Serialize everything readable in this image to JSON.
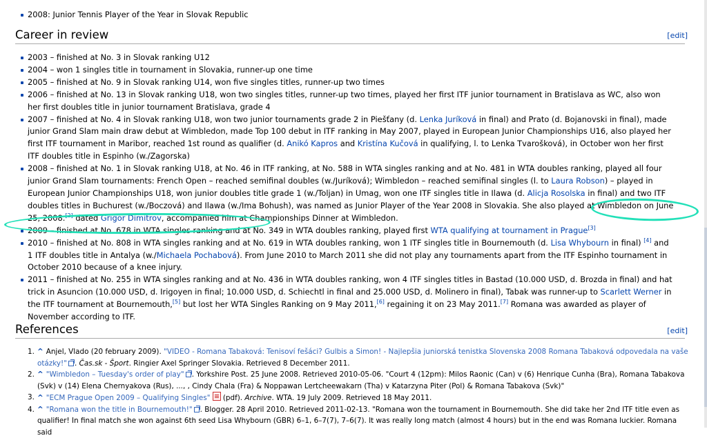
{
  "top_item": "2008: Junior Tennis Player of the Year in Slovak Republic",
  "career": {
    "heading": "Career in review",
    "edit": "[edit]",
    "items": {
      "i2003": "2003 – finished at No. 3 in Slovak ranking U12",
      "i2004": "2004 – won 1 singles title in tournament in Slovakia, runner-up one time",
      "i2005": "2005 – finished at No. 9 in Slovak ranking U14, won five singles titles, runner-up two times",
      "i2006": "2006 – finished at No. 13 in Slovak ranking U18, won two singles titles, runner-up two times, played her first ITF junior tournament in Bratislava as WC, also won her first doubles title in junior tournament Bratislava, grade 4",
      "i2007": {
        "t1": "2007 – finished at No. 4 in Slovak ranking U18, won two junior tournaments grade 2 in Piešťany (d. ",
        "l1": "Lenka Juríková",
        "t2": " in final) and Prato (d. Bojanovski in final), made junior Grand Slam main draw debut at Wimbledon, made Top 100 debut in ITF ranking in May 2007, played in European Junior Championships U16, also played her first ITF tournament in Maribor, reached 1st round as qualifier (d. ",
        "l2": "Anikó Kapros",
        "t3": " and ",
        "l3": "Kristína Kučová",
        "t4": " in qualifying, l. to Lenka Tvarošková), in October won her first ITF doubles title in Espinho (w./Zagorska)"
      },
      "i2008": {
        "t1": "2008 – finished at No. 1 in Slovak ranking U18, at No. 46 in ITF ranking, at No. 588 in WTA singles ranking and at No. 481 in WTA doubles ranking, played all four junior Grand Slam tournaments: French Open – reached semifinal doubles (w./Juríková); Wimbledon – reached semifinal singles (l. to ",
        "l1": "Laura Robson",
        "t2": ") – played in European Junior Championships U18, won junior doubles title grade 1 (w./Toljan) in Umag, won one ITF singles title in Ilawa (d. ",
        "l2": "Alicja Rosolska",
        "t3": " in final) and two ITF doubles titles in Buchurest (w./Boczová) and Ilawa (w./Ima Bohush), was named as Junior Player of the Year 2008 in Slovakia. She also played at Wimbledon on June 25, 2008.",
        "ref": "[2]",
        "t4": " dated ",
        "l3": "Grigor Dimitrov",
        "t5": ", accompanied him at Championships Dinner at Wimbledon."
      },
      "i2009": {
        "t1": "2009 – finished at No. 678 in WTA singles ranking and at No. 349 in WTA doubles ranking, played first ",
        "l1": "WTA qualifying at tournament in Prague",
        "ref": "[3]"
      },
      "i2010": {
        "t1": "2010 – finished at No. 808 in WTA singles ranking and at No. 619 in WTA doubles ranking, won 1 ITF singles title in Bournemouth (d. ",
        "l1": "Lisa Whybourn",
        "t2": " in final) ",
        "ref": "[4]",
        "t3": " and 1 ITF doubles title in Antalya (w./",
        "l2": "Michaela Pochabová",
        "t4": "). From June 2010 to March 2011 she did not play any tournaments apart from the ITF Espinho tournament in October 2010 because of a knee injury."
      },
      "i2011": {
        "t1": "2011 – finished at No. 255 in WTA singles ranking and at No. 436 in WTA doubles ranking, won 4 ITF singles titles in Bastad (10.000 USD, d. Brozda in final) and hat trick in Asuncion (10.000 USD, d. Irigoyen in final; 10.000 USD, d. Schiechtl in final and 25.000 USD, d. Molinero in final), Tabak was runner-up to ",
        "l1": "Scarlett Werner",
        "t2": " in the ITF tournament at Bournemouth,",
        "ref1": "[5]",
        "t3": " but lost her WTA Singles Ranking on 9 May 2011,",
        "ref2": "[6]",
        "t4": " regaining it on 23 May 2011.",
        "ref3": "[7]",
        "t5": " Romana was awarded as player of November according to ITF."
      }
    }
  },
  "references": {
    "heading": "References",
    "edit": "[edit]",
    "caret": "^",
    "r1": {
      "num": "1.",
      "t1": "Anjel, Vlado (20 february 2009). ",
      "link": "\"VIDEO - Romana Tabaková: Tenisoví fešáci? Gulbis a Simon! - Najlepšia juniorská tenistka Slovenska 2008 Romana Tabaková odpovedala na vaše otázky!\"",
      "t2": ". ",
      "pub": "Čas.sk - Šport",
      "t3": ". Ringier Axel Springer Slovakia. Retrieved 8 December 2011."
    },
    "r2": {
      "num": "2.",
      "link": "\"Wimbledon – Tuesday's order of play\"",
      "t1": ". Yorkshire Post. 25 June 2008. Retrieved 2010-05-06. \"Court 4 (12pm): Milos Raonic (Can) v (6) Henrique Cunha (Bra), Romana Tabakova (Svk) v (14) Elena Chernyakova (Rus), ..., , Cindy Chala (Fra) & Noppawan Lertcheewakarn (Tha) v Katarzyna Piter (Pol) & Romana Tabakova (Svk)\""
    },
    "r3": {
      "num": "3.",
      "link": "\"ECM Prague Open 2009 – Qualifying Singles\"",
      "t1": " (pdf). ",
      "pub": "Archive",
      "t2": ". WTA. 19 July 2009. Retrieved 18 May 2011."
    },
    "r4": {
      "num": "4.",
      "link": "\"Romana won the title in Bournemouth!\"",
      "t1": ". Blogger. 28 April 2010. Retrieved 2011-02-13. \"Romana won the tournament in Bournemouth. She did take her 2nd ITF title even as qualifier! In final match she won against 6th seed Lisa Whybourn (GBR) 6–1, 6–7(7), 7–6(7). It was really long match (almost 4 hours) but in the end was Romana luckier. Romana said"
    }
  },
  "colors": {
    "link": "#0645ad",
    "highlight": "#22e0b8",
    "rule": "#aaaaaa"
  }
}
